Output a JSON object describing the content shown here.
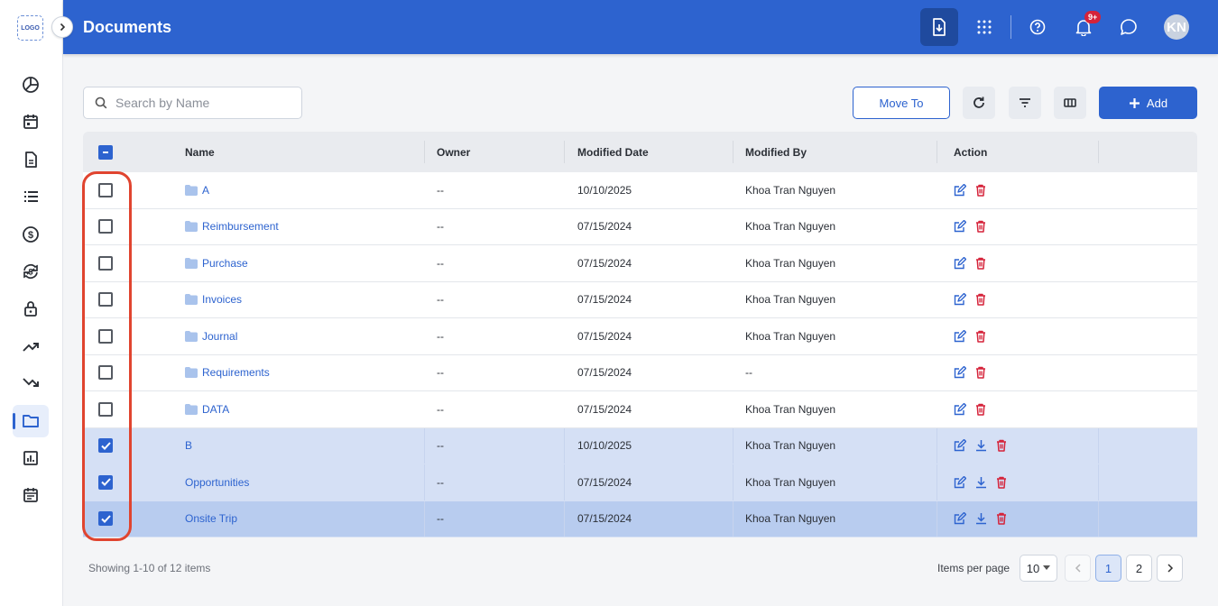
{
  "app": {
    "logo_text": "LOGO",
    "page_title": "Documents",
    "avatar_initials": "KN",
    "notification_badge": "9+"
  },
  "rail": {
    "items": [
      {
        "icon": "pie-chart-icon",
        "active": false
      },
      {
        "icon": "calendar-icon",
        "active": false
      },
      {
        "icon": "document-icon",
        "active": false
      },
      {
        "icon": "list-icon",
        "active": false
      },
      {
        "icon": "dollar-icon",
        "active": false
      },
      {
        "icon": "currency-exchange-icon",
        "active": false
      },
      {
        "icon": "lock-icon",
        "active": false
      },
      {
        "icon": "trending-up-icon",
        "active": false
      },
      {
        "icon": "trending-down-icon",
        "active": false
      },
      {
        "icon": "folder-icon",
        "active": true
      },
      {
        "icon": "report-chart-icon",
        "active": false
      },
      {
        "icon": "event-note-icon",
        "active": false
      }
    ]
  },
  "toolbar": {
    "search_placeholder": "Search by Name",
    "move_to_label": "Move To",
    "add_label": "Add"
  },
  "table": {
    "columns": [
      "Name",
      "Owner",
      "Modified Date",
      "Modified By",
      "Action"
    ],
    "rows": [
      {
        "name": "A",
        "folder": true,
        "owner": "--",
        "modified_date": "10/10/2025",
        "modified_by": "Khoa Tran Nguyen",
        "checked": false
      },
      {
        "name": "Reimbursement",
        "folder": true,
        "owner": "--",
        "modified_date": "07/15/2024",
        "modified_by": "Khoa Tran Nguyen",
        "checked": false
      },
      {
        "name": "Purchase",
        "folder": true,
        "owner": "--",
        "modified_date": "07/15/2024",
        "modified_by": "Khoa Tran Nguyen",
        "checked": false
      },
      {
        "name": "Invoices",
        "folder": true,
        "owner": "--",
        "modified_date": "07/15/2024",
        "modified_by": "Khoa Tran Nguyen",
        "checked": false
      },
      {
        "name": "Journal",
        "folder": true,
        "owner": "--",
        "modified_date": "07/15/2024",
        "modified_by": "Khoa Tran Nguyen",
        "checked": false
      },
      {
        "name": "Requirements",
        "folder": true,
        "owner": "--",
        "modified_date": "07/15/2024",
        "modified_by": "--",
        "checked": false
      },
      {
        "name": "DATA",
        "folder": true,
        "owner": "--",
        "modified_date": "07/15/2024",
        "modified_by": "Khoa Tran Nguyen",
        "checked": false
      },
      {
        "name": "B",
        "folder": false,
        "owner": "--",
        "modified_date": "10/10/2025",
        "modified_by": "Khoa Tran Nguyen",
        "checked": true
      },
      {
        "name": "Opportunities",
        "folder": false,
        "owner": "--",
        "modified_date": "07/15/2024",
        "modified_by": "Khoa Tran Nguyen",
        "checked": true
      },
      {
        "name": "Onsite Trip",
        "folder": false,
        "owner": "--",
        "modified_date": "07/15/2024",
        "modified_by": "Khoa Tran Nguyen",
        "checked": true
      }
    ]
  },
  "footer": {
    "showing": "Showing 1-10 of 12 items",
    "items_per_page_label": "Items per page",
    "items_per_page_value": "10",
    "pages": [
      "1",
      "2"
    ],
    "current_page": "1"
  },
  "colors": {
    "primary": "#2d63cf",
    "danger": "#d5233a",
    "highlight": "#e0442f",
    "selected_row": "#d5e0f5"
  }
}
